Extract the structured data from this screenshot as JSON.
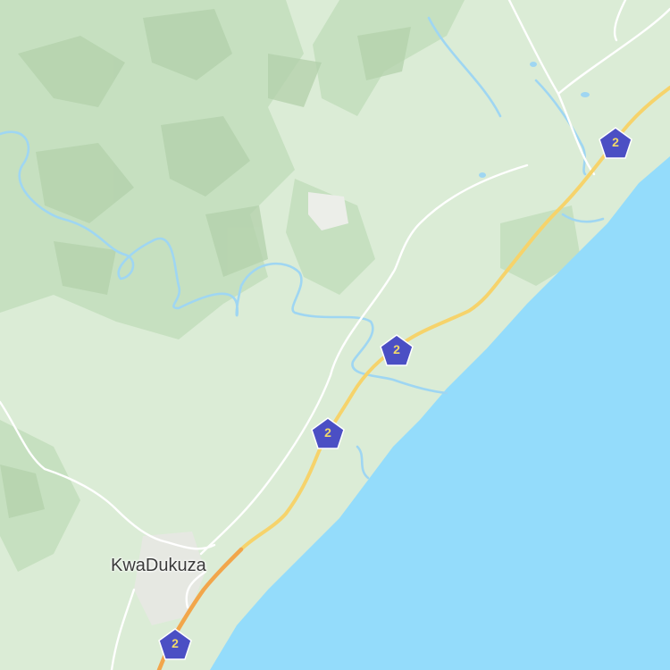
{
  "map": {
    "places": [
      {
        "name": "KwaDukuza"
      }
    ],
    "route_shields": [
      {
        "label": "2"
      },
      {
        "label": "2"
      },
      {
        "label": "2"
      },
      {
        "label": "2"
      }
    ],
    "colors": {
      "land": "#dbecd6",
      "forest": "#c8e2c2",
      "relief": "#b9d6b2",
      "ocean": "#94dcfb",
      "river": "#9fd6f2",
      "highway": "#f6d36b",
      "highway_urban": "#f2a64b",
      "minor_road": "#ffffff",
      "shield_fill": "#4b4fc4",
      "shield_text": "#f2d96a",
      "urban": "#e8e9e4"
    }
  }
}
